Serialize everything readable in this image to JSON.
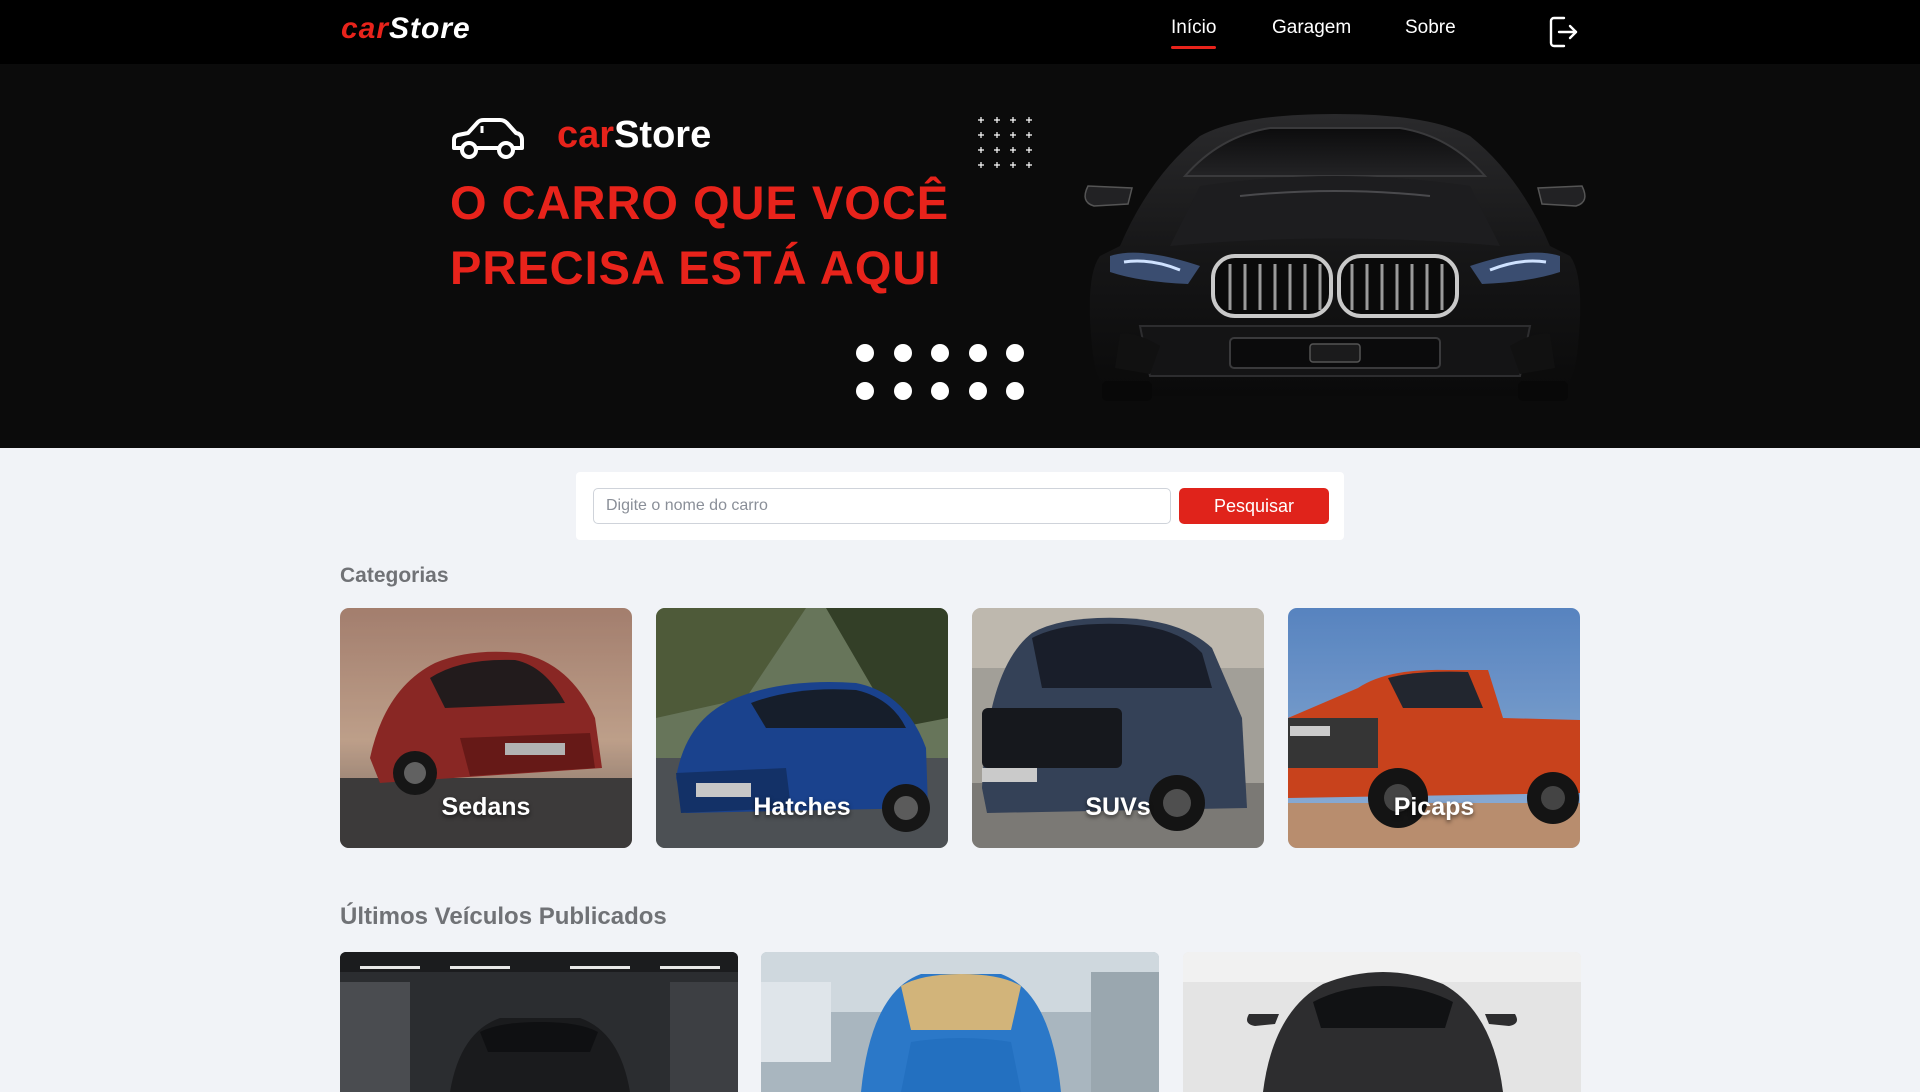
{
  "navbar": {
    "brand_prefix": "car",
    "brand_suffix": "Store",
    "links": [
      {
        "label": "Início",
        "active": true
      },
      {
        "label": "Garagem",
        "active": false
      },
      {
        "label": "Sobre",
        "active": false
      }
    ],
    "logout_icon": "logout-icon"
  },
  "hero": {
    "logo_icon": "car-outline-icon",
    "brand_prefix": "car",
    "brand_suffix": "Store",
    "headline_line1": "O CARRO QUE VOCÊ",
    "headline_line2": "PRECISA ESTÁ AQUI"
  },
  "search": {
    "placeholder": "Digite o nome do carro",
    "value": "",
    "button_label": "Pesquisar"
  },
  "categories": {
    "title": "Categorias",
    "items": [
      {
        "label": "Sedans"
      },
      {
        "label": "Hatches"
      },
      {
        "label": "SUVs"
      },
      {
        "label": "Picaps"
      }
    ]
  },
  "latest": {
    "title": "Últimos Veículos Publicados"
  },
  "colors": {
    "accent": "#e8231b",
    "navbar_bg": "#000000",
    "hero_bg": "#0b0b0b",
    "page_bg": "#f1f3f7"
  }
}
